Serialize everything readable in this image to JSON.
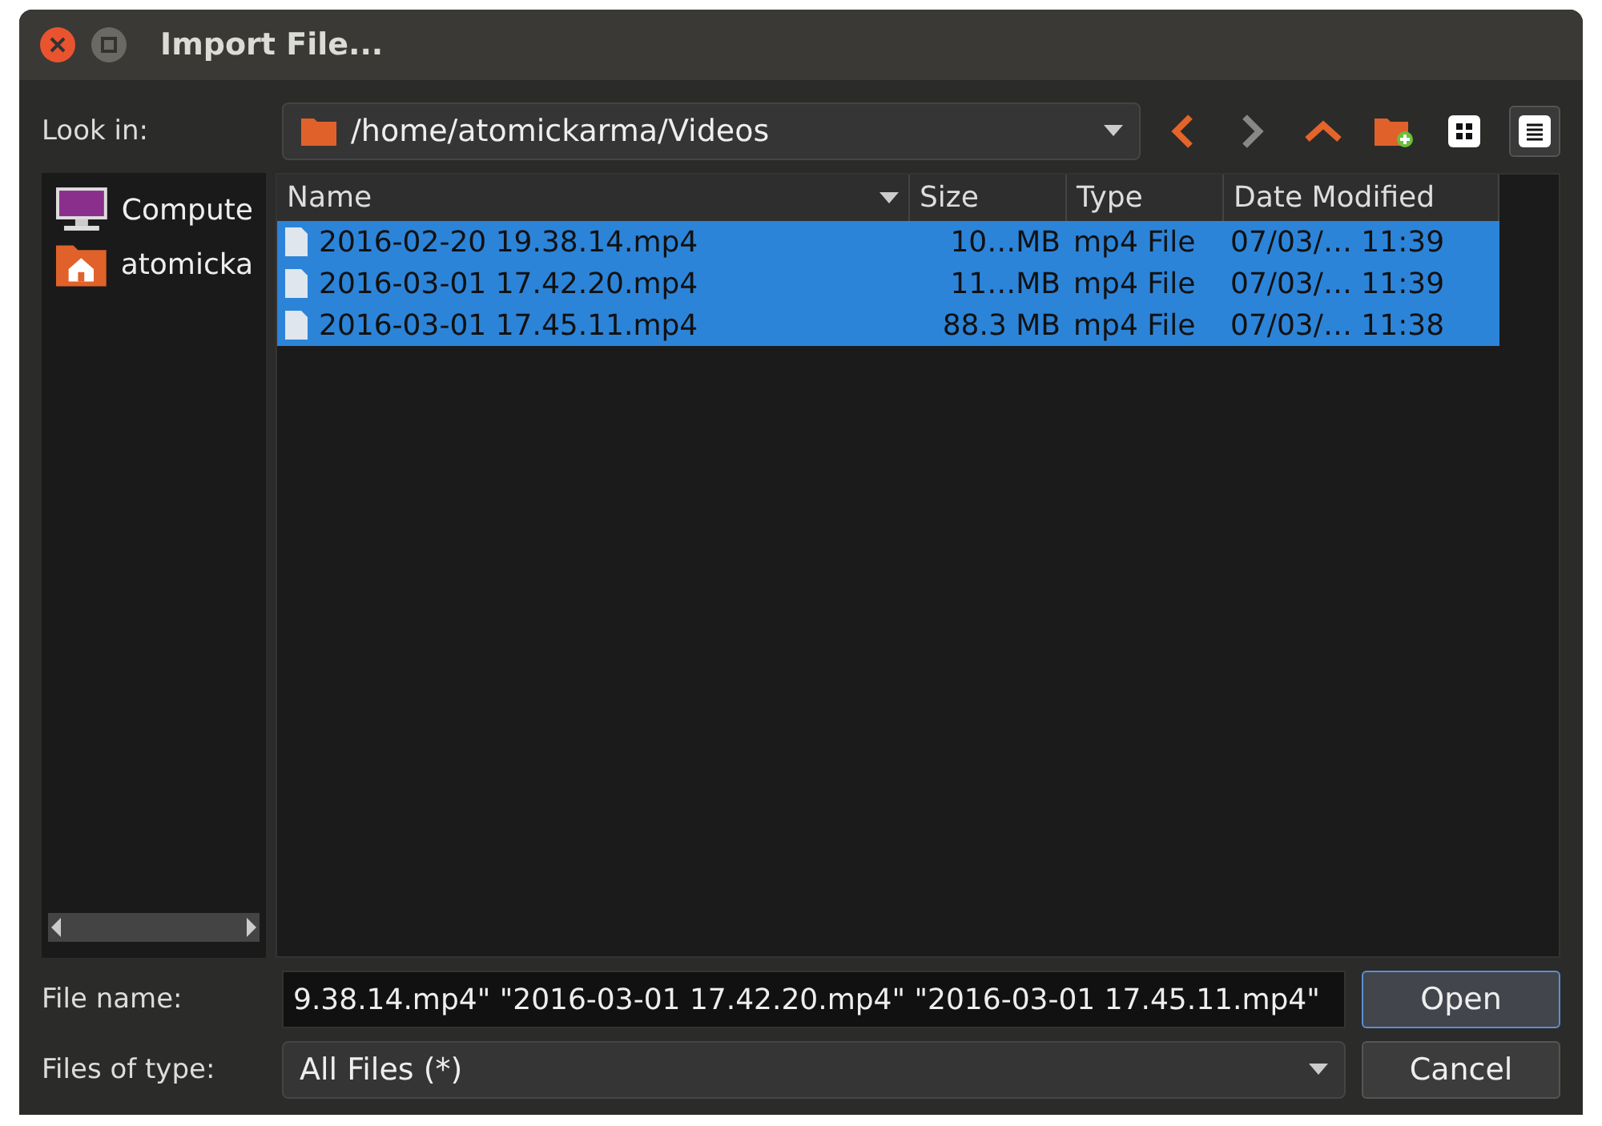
{
  "window": {
    "title": "Import File..."
  },
  "look_in": {
    "label": "Look in:",
    "path": "/home/atomickarma/Videos"
  },
  "toolbar": [
    {
      "kind": "back"
    },
    {
      "kind": "forward"
    },
    {
      "kind": "up"
    },
    {
      "kind": "new-folder"
    },
    {
      "kind": "icon-view",
      "selected": false
    },
    {
      "kind": "detail-view",
      "selected": true
    }
  ],
  "sidebar": {
    "items": [
      {
        "kind": "computer",
        "label": "Compute"
      },
      {
        "kind": "home",
        "label": "atomicka"
      }
    ]
  },
  "table": {
    "columns": [
      "Name",
      "Size",
      "Type",
      "Date Modified"
    ],
    "rows": [
      {
        "selected": true,
        "cells": [
          "2016-02-20 19.38.14.mp4",
          "10…MB",
          "mp4 File",
          "07/03/… 11:39"
        ]
      },
      {
        "selected": true,
        "cells": [
          "2016-03-01 17.42.20.mp4",
          "11…MB",
          "mp4 File",
          "07/03/… 11:39"
        ]
      },
      {
        "selected": true,
        "cells": [
          "2016-03-01 17.45.11.mp4",
          "88.3 MB",
          "mp4 File",
          "07/03/… 11:38"
        ]
      }
    ]
  },
  "file_name": {
    "label": "File name:",
    "value": "9.38.14.mp4\" \"2016-03-01 17.42.20.mp4\" \"2016-03-01 17.45.11.mp4\""
  },
  "file_type": {
    "label": "Files of type:",
    "value": "All Files (*)"
  },
  "buttons": [
    "Open",
    "Cancel"
  ]
}
